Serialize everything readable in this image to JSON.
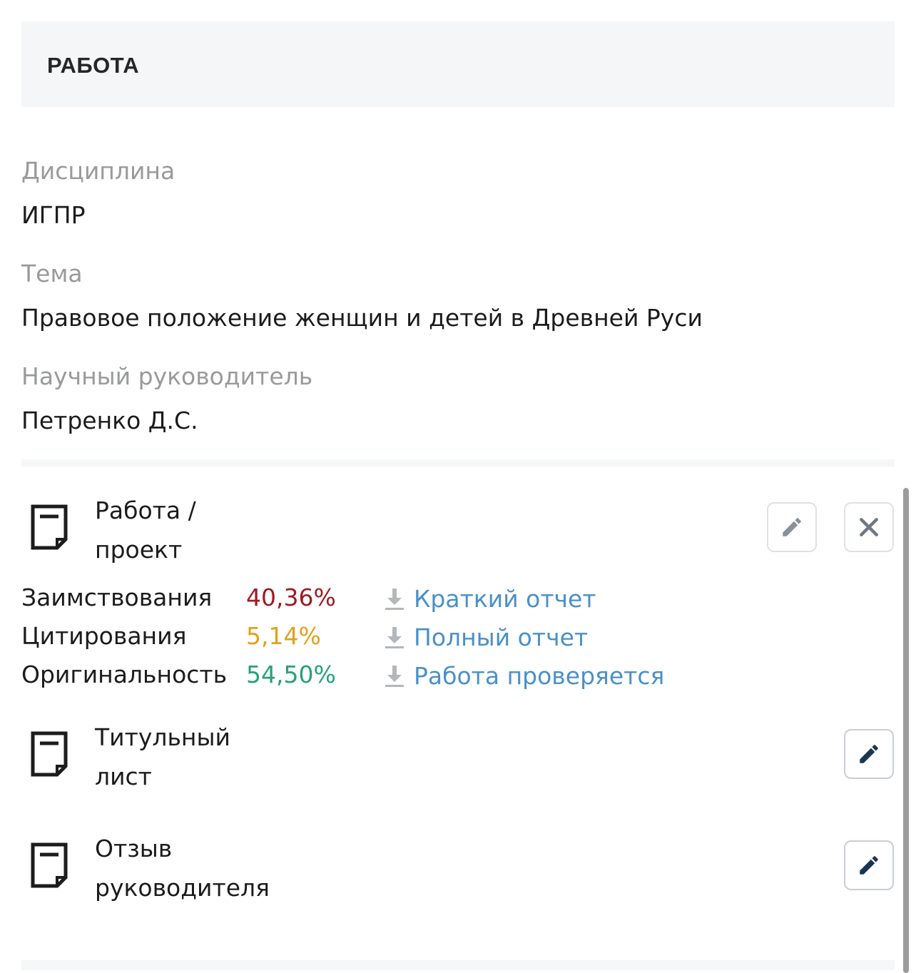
{
  "header": {
    "title": "РАБОТА"
  },
  "fields": [
    {
      "label": "Дисциплина",
      "value": "ИГПР"
    },
    {
      "label": "Тема",
      "value": "Правовое положение женщин и детей в Древней Руси"
    },
    {
      "label": "Научный руководитель",
      "value": "Петренко Д.С."
    }
  ],
  "documents": [
    {
      "title": "Работа / проект",
      "actions": [
        "edit",
        "delete"
      ],
      "icon": "document-icon"
    },
    {
      "title": "Титульный лист",
      "actions": [
        "edit"
      ],
      "icon": "document-icon"
    },
    {
      "title": "Отзыв руководителя",
      "actions": [
        "edit"
      ],
      "icon": "document-icon"
    }
  ],
  "check": {
    "stats": [
      {
        "label": "Заимствования",
        "value": "40,36%",
        "color": "#9e1b23"
      },
      {
        "label": "Цитирования",
        "value": "5,14%",
        "color": "#e0a21c"
      },
      {
        "label": "Оригинальность",
        "value": "54,50%",
        "color": "#27a17a"
      }
    ],
    "links": [
      {
        "label": "Краткий отчет",
        "icon": "download-icon"
      },
      {
        "label": "Полный отчет",
        "icon": "download-icon"
      },
      {
        "label": "Работа проверяется",
        "icon": "download-icon"
      }
    ]
  },
  "colors": {
    "link": "#4a90c8",
    "label_gray": "#999a9c",
    "panel_bg": "#f5f6f7"
  }
}
